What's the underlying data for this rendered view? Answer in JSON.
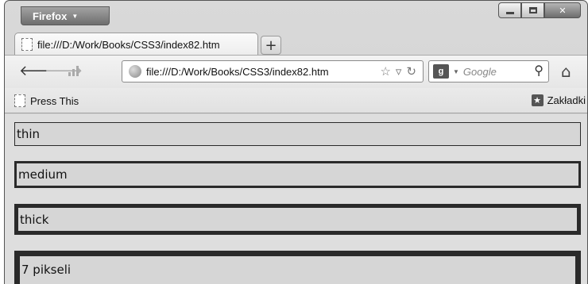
{
  "browser": {
    "menu_label": "Firefox",
    "tab_title": "file:///D:/Work/Books/CSS3/index82.htm",
    "new_tab_label": "+",
    "url": "file:///D:/Work/Books/CSS3/index82.htm",
    "search_placeholder": "Google",
    "bookmarks": {
      "left_item": "Press This",
      "right_item": "Zakładki"
    }
  },
  "content": {
    "boxes": [
      {
        "label": "thin"
      },
      {
        "label": "medium"
      },
      {
        "label": "thick"
      },
      {
        "label": "7 pikseli"
      }
    ]
  },
  "colors": {
    "border": "#2a2a2a",
    "box_fill": "#d6d6d6"
  }
}
